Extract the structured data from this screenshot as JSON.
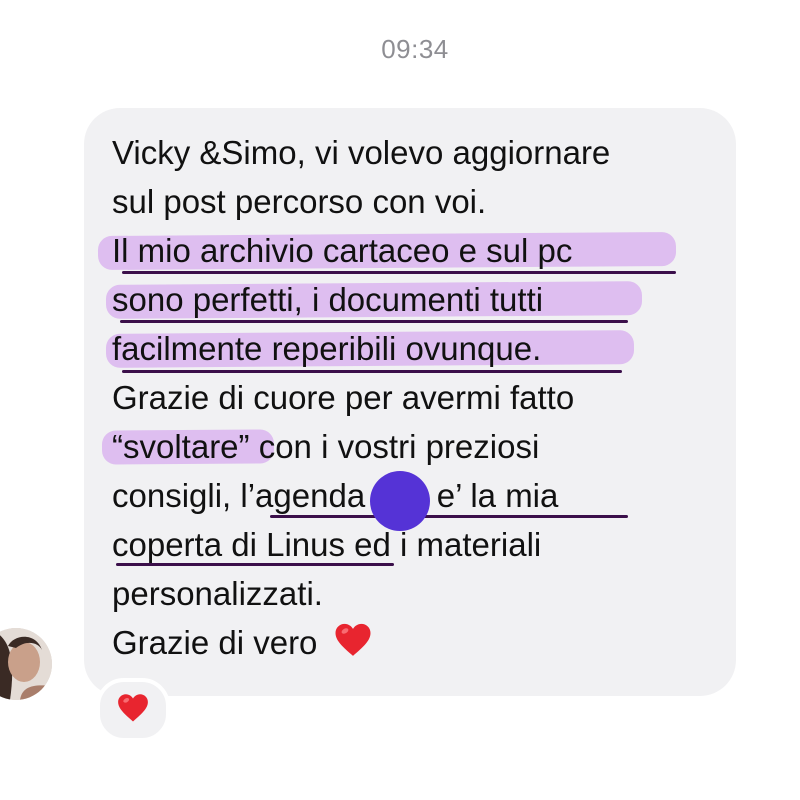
{
  "conversation": {
    "timestamp": "09:34",
    "message": {
      "lines": [
        "Vicky &Simo, vi volevo aggiornare",
        "sul post percorso con voi.",
        "Il mio archivio cartaceo e sul pc",
        "sono perfetti, i documenti tutti",
        "facilmente reperibili ovunque.",
        "Grazie di cuore per avermi fatto",
        "“svoltare” con i vostri preziosi",
        "consigli, l’agenda che e’ la mia",
        "coperta di Linus ed i materiali",
        "personalizzati.",
        "Grazie di vero"
      ],
      "emoji": "heart-icon",
      "highlight_color": "#d6a8ee",
      "underline_color": "#3b0f4a"
    },
    "sender_avatar": "avatar",
    "reaction": "heart-icon",
    "overlay_dot_color": "#5533d6"
  }
}
